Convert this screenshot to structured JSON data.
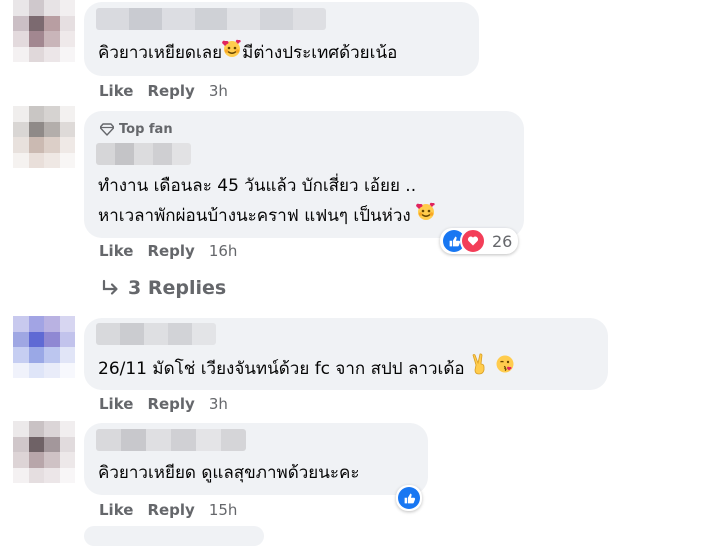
{
  "comments": [
    {
      "text_lines": [
        "คิวยาวเหยียดเลย",
        "มีต่างประเทศด้วยเน้อ"
      ],
      "like": "Like",
      "reply": "Reply",
      "time": "3h"
    },
    {
      "badge": "Top fan",
      "text_lines": [
        "ทำงาน เดือนละ 45 วันแล้ว บักเสี่ยว เอ้ยย ..",
        "หาเวลาพักผ่อนบ้างนะคราฟ แฟนๆ เป็นห่วง"
      ],
      "like": "Like",
      "reply": "Reply",
      "time": "16h",
      "reaction_count": "26",
      "replies_label": "3 Replies"
    },
    {
      "text_lines": [
        "26/11 มัดโช่ เวียงจันทน์ด้วย fc จาก สปป ลาวเด้อ"
      ],
      "like": "Like",
      "reply": "Reply",
      "time": "3h"
    },
    {
      "text_lines": [
        "คิวยาวเหยียด ดูแลสุขภาพด้วยนะคะ"
      ],
      "like": "Like",
      "reply": "Reply",
      "time": "15h"
    }
  ],
  "colors": {
    "bubble": "#f0f2f5",
    "meta_text": "#65676b",
    "like_blue": "#1877f2",
    "love_red": "#f33e58"
  }
}
